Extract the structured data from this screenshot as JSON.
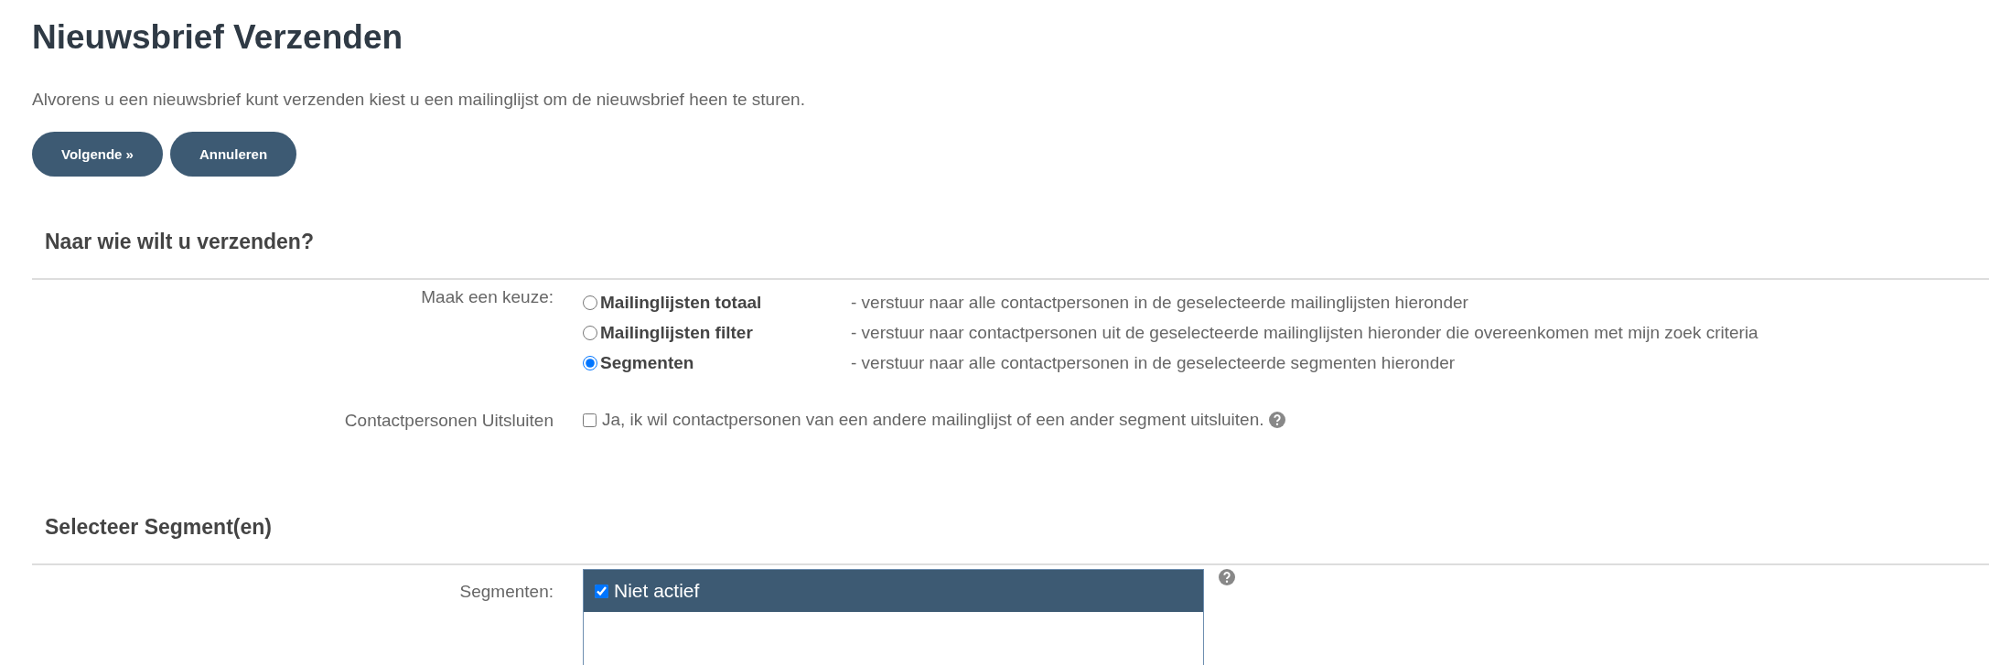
{
  "title": "Nieuwsbrief Verzenden",
  "intro": "Alvorens u een nieuwsbrief kunt verzenden kiest u een mailinglijst om de nieuwsbrief heen te sturen.",
  "buttons": [
    "Volgende »",
    "Annuleren"
  ],
  "section_1": {
    "heading": "Naar wie wilt u verzenden?",
    "choice_label": "Maak een keuze:",
    "options": [
      {
        "label": "Mailinglijsten totaal",
        "description": "- verstuur naar alle contactpersonen in de geselecteerde mailinglijsten hieronder",
        "selected": false
      },
      {
        "label": "Mailinglijsten filter",
        "description": "- verstuur naar contactpersonen uit de geselecteerde mailinglijsten hieronder die overeenkomen met mijn zoek criteria",
        "selected": false
      },
      {
        "label": "Segmenten",
        "description": "- verstuur naar alle contactpersonen in de geselecteerde segmenten hieronder",
        "selected": true
      }
    ],
    "exclude_label": "Contactpersonen Uitsluiten",
    "exclude": {
      "label": "Ja, ik wil contactpersonen van een andere mailinglijst of een ander segment uitsluiten.",
      "checked": false
    }
  },
  "section_2": {
    "heading": "Selecteer Segment(en)",
    "segments_label": "Segmenten:",
    "segments": [
      {
        "label": "Niet actief",
        "checked": true
      }
    ]
  }
}
